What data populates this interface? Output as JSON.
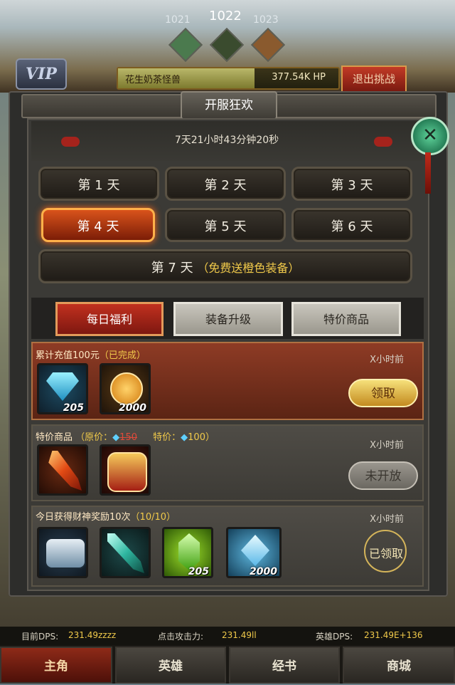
{
  "hud": {
    "stages": [
      "1021",
      "1022",
      "1023"
    ],
    "vip_label": "VIP",
    "boss_name": "花生奶茶怪兽",
    "boss_hp": "377.54K HP",
    "boss_hp_fraction": 0.62,
    "quit_label": "退出挑战"
  },
  "panel": {
    "title": "开服狂欢",
    "countdown": "7天21小时43分钟20秒",
    "days": [
      {
        "label": "第 1 天",
        "selected": false
      },
      {
        "label": "第 2 天",
        "selected": false
      },
      {
        "label": "第 3 天",
        "selected": false
      },
      {
        "label": "第 4 天",
        "selected": true
      },
      {
        "label": "第 5 天",
        "selected": false
      },
      {
        "label": "第 6 天",
        "selected": false
      }
    ],
    "day7": {
      "label": "第 7 天",
      "note": "（免费送橙色装备）"
    },
    "tabs": [
      {
        "label": "每日福利",
        "active": true
      },
      {
        "label": "装备升级",
        "active": false
      },
      {
        "label": "特价商品",
        "active": false
      }
    ],
    "rows": [
      {
        "title": "累计充值100元",
        "status": "（已完成）",
        "time": "X小时前",
        "items": [
          {
            "icon": "blue-diamond-icon",
            "qty": "205"
          },
          {
            "icon": "gold-coin-icon",
            "qty": "2000"
          }
        ],
        "button": "领取"
      },
      {
        "title": "特价商品",
        "orig_label": "（原价：",
        "orig_price": "150",
        "deal_label": "特价：",
        "deal_price": "100）",
        "time": "X小时前",
        "items": [
          {
            "icon": "flame-sword-icon",
            "qty": ""
          },
          {
            "icon": "red-armor-icon",
            "qty": ""
          }
        ],
        "button": "未开放"
      },
      {
        "title": "今日获得财神奖励10次",
        "progress": "（10/10）",
        "time": "X小时前",
        "items": [
          {
            "icon": "steel-gauntlet-icon",
            "qty": ""
          },
          {
            "icon": "jade-sword-icon",
            "qty": ""
          },
          {
            "icon": "green-gem-icon",
            "qty": "205"
          },
          {
            "icon": "blue-crystal-icon",
            "qty": "2000"
          }
        ],
        "button": "已领取"
      }
    ]
  },
  "status": {
    "dps_label": "目前DPS:",
    "dps_value": "231.49zzzz",
    "atk_label": "点击攻击力:",
    "atk_value": "231.49ll",
    "hero_label": "英雄DPS:",
    "hero_value": "231.49E+136"
  },
  "nav": [
    "主角",
    "英雄",
    "经书",
    "商城"
  ],
  "colors": {
    "accent": "#d9531b",
    "gold": "#f0c94a",
    "panel": "#3b3a36"
  }
}
